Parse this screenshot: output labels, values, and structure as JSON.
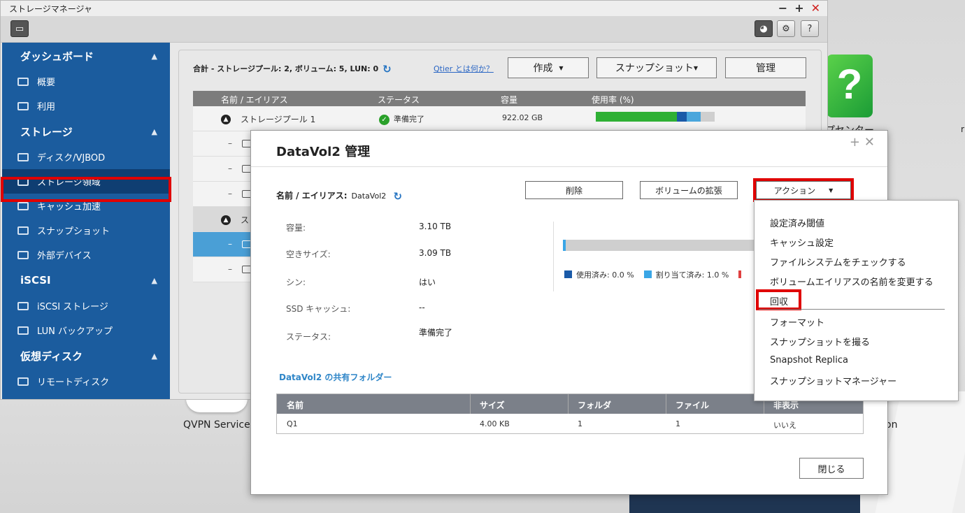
{
  "desktop": {
    "help_label": "プセンター",
    "vpn_label": "QVPN Service",
    "on_label": "on",
    "r_label": "r"
  },
  "window": {
    "title": "ストレージマネージャ"
  },
  "sidebar": {
    "groups": [
      {
        "label": "ダッシュボード",
        "items": [
          {
            "label": "概要"
          },
          {
            "label": "利用"
          }
        ]
      },
      {
        "label": "ストレージ",
        "items": [
          {
            "label": "ディスク/VJBOD"
          },
          {
            "label": "ストレージ領域"
          },
          {
            "label": "キャッシュ加速"
          },
          {
            "label": "スナップショット"
          },
          {
            "label": "外部デバイス"
          }
        ]
      },
      {
        "label": "iSCSI",
        "items": [
          {
            "label": "iSCSI ストレージ"
          },
          {
            "label": "LUN バックアップ"
          }
        ]
      },
      {
        "label": "仮想ディスク",
        "items": [
          {
            "label": "リモートディスク"
          }
        ]
      }
    ]
  },
  "content": {
    "summary": "合計 - ストレージプール: 2, ボリューム: 5, LUN: 0",
    "qtier_link": "Qtier とは何か？",
    "create_btn": "作成",
    "snapshot_btn": "スナップショット",
    "manage_btn": "管理",
    "columns": [
      "名前 / エイリアス",
      "ステータス",
      "容量",
      "使用率 (%)"
    ],
    "pool1": {
      "name": "ストレージプール 1",
      "status": "準備完了",
      "capacity": "922.02 GB"
    },
    "pool2_name": "スト",
    "dash": "–",
    "usage": {
      "used": 0.68,
      "seg2": 0.08,
      "seg3": 0.12
    }
  },
  "dialog": {
    "title": "DataVol2 管理",
    "name_label": "名前 / エイリアス:",
    "name_value": "DataVol2",
    "delete_btn": "削除",
    "expand_btn": "ボリュームの拡張",
    "action_btn": "アクション",
    "props": [
      {
        "label": "容量:",
        "value": "3.10 TB"
      },
      {
        "label": "空きサイズ:",
        "value": "3.09 TB"
      },
      {
        "label": "シン:",
        "value": "はい"
      },
      {
        "label": "SSD キャッシュ:",
        "value": "--"
      },
      {
        "label": "ステータス:",
        "value": "準備完了"
      }
    ],
    "legend_used": "使用済み:  0.0 %",
    "legend_alloc": "割り当て済み:  1.0 %",
    "used_fraction": 0.0,
    "shared_title": "DataVol2 の共有フォルダー",
    "shared_columns": [
      "名前",
      "サイズ",
      "フォルダ",
      "ファイル",
      "非表示"
    ],
    "shared_rows": [
      [
        "Q1",
        "4.00 KB",
        "1",
        "1",
        "いいえ"
      ]
    ],
    "close_btn": "閉じる"
  },
  "menu": {
    "items": [
      "設定済み閾値",
      "キャッシュ設定",
      "ファイルシステムをチェックする",
      "ボリュームエイリアスの名前を変更する",
      "回収",
      "フォーマット",
      "スナップショットを撮る",
      "Snapshot Replica",
      "スナップショットマネージャー"
    ]
  },
  "colors": {
    "sidebar_bg": "#1b5c9e",
    "highlight": "#e00000",
    "usage_green": "#2fb035",
    "usage_blue": "#1a5aa8",
    "usage_lightblue": "#4aa6dc",
    "legend_used": "#1a5aa8",
    "legend_alloc": "#3aa6e6",
    "legend_other": "#e04040"
  }
}
